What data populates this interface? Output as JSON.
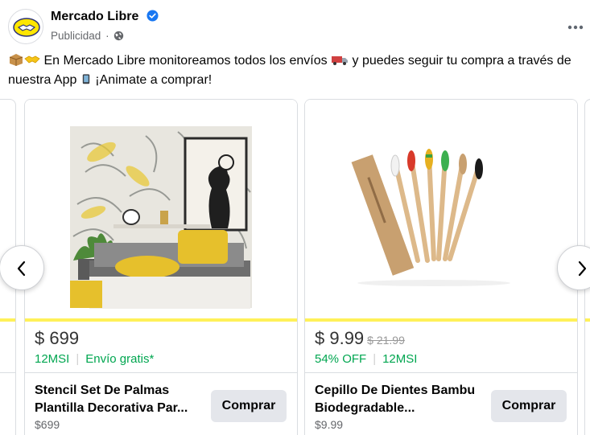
{
  "post": {
    "page_name": "Mercado Libre",
    "sponsored_label": "Publicidad",
    "separator": "·",
    "more_icon": "more-horizontal-icon",
    "text_line1": " En Mercado Libre monitoreamos todos los envíos ",
    "text_line1_end": " y puedes seguir tu compra a través de",
    "text_line2": "nuestra App ",
    "text_line2_end": " ¡Animate a comprar!"
  },
  "colors": {
    "accent_stripe": "#fff159",
    "discount_green": "#00a650",
    "verified_blue": "#1877f2",
    "button_gray": "#e4e6eb"
  },
  "carousel": {
    "prev_icon": "chevron-left-icon",
    "next_icon": "chevron-right-icon",
    "cards": [
      {
        "price": "$ 699",
        "old_price": "",
        "tag1": "12MSI",
        "tag2": "Envío gratis*",
        "title": "Stencil Set De Palmas Plantilla Decorativa Par...",
        "subprice": "$699",
        "button": "Comprar"
      },
      {
        "price": "$ 9.99",
        "old_price": "$ 21.99",
        "tag1": "54% OFF",
        "tag2": "12MSI",
        "title": "Cepillo De Dientes Bambu Biodegradable...",
        "subprice": "$9.99",
        "button": "Comprar"
      }
    ]
  }
}
